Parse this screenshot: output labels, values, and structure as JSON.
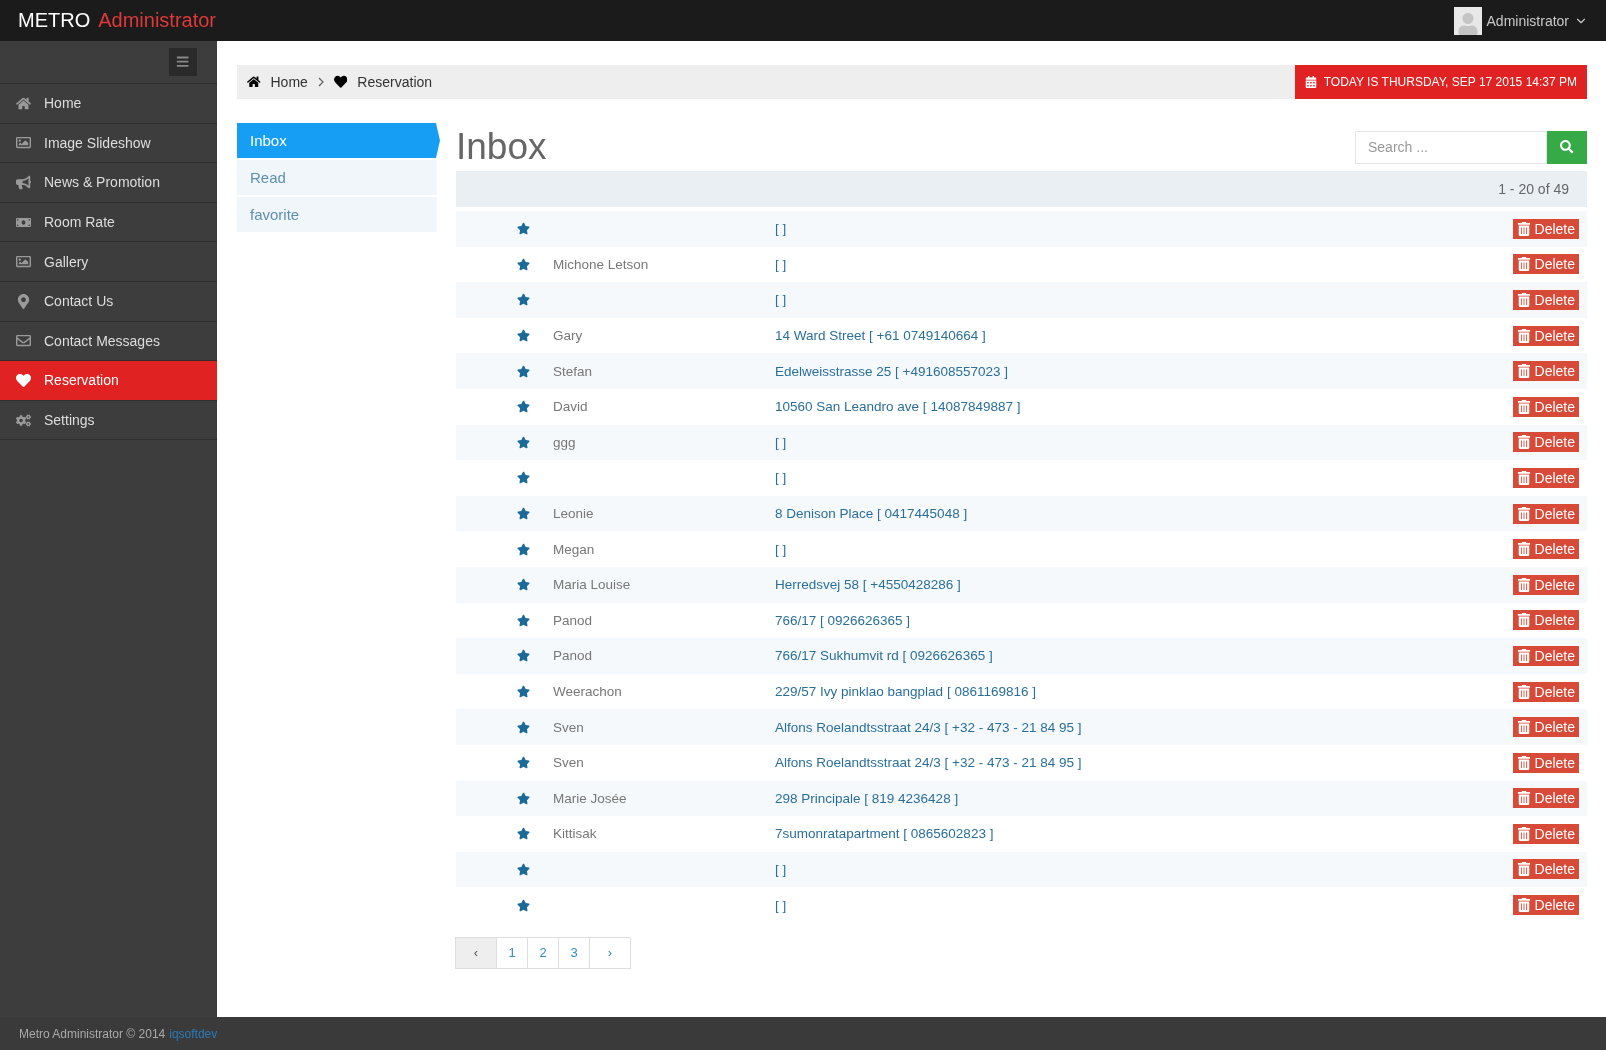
{
  "top_bar": {
    "brand": "METRO",
    "brand_accent": "Administrator",
    "user": "Administrator"
  },
  "sidebar": {
    "items": [
      {
        "label": "Home",
        "selected": false
      },
      {
        "label": "Image Slideshow",
        "selected": false
      },
      {
        "label": "News & Promotion",
        "selected": false
      },
      {
        "label": "Room Rate",
        "selected": false
      },
      {
        "label": "Gallery",
        "selected": false
      },
      {
        "label": "Contact Us",
        "selected": false
      },
      {
        "label": "Contact Messages",
        "selected": false
      },
      {
        "label": "Reservation",
        "selected": true
      },
      {
        "label": "Settings",
        "selected": false
      }
    ]
  },
  "breadcrumb": [
    {
      "label": "Home"
    },
    {
      "label": "Reservation"
    }
  ],
  "date_banner": "TODAY IS THURSDAY, SEP 17 2015 14:37 PM",
  "folders": [
    {
      "label": "Inbox",
      "selected": true
    },
    {
      "label": "Read",
      "selected": false
    },
    {
      "label": "favorite",
      "selected": false
    }
  ],
  "heading": "Inbox",
  "search": {
    "placeholder": "Search ..."
  },
  "range": "1 - 20 of 49",
  "rows": [
    {
      "contact": "[ ]",
      "action": "Delete"
    },
    {
      "name": "Michone Letson",
      "contact": "[ ]",
      "action": "Delete"
    },
    {
      "contact": "[ ]",
      "action": "Delete"
    },
    {
      "name": "Gary",
      "contact": "14 Ward Street [ +61 0749140664 ]",
      "action": "Delete"
    },
    {
      "name": "Stefan",
      "contact": "Edelweisstrasse 25 [ +491608557023 ]",
      "action": "Delete"
    },
    {
      "name": "David",
      "contact": "10560 San Leandro ave [ 14087849887 ]",
      "action": "Delete"
    },
    {
      "name": "ggg",
      "contact": "[ ]",
      "action": "Delete"
    },
    {
      "contact": "[ ]",
      "action": "Delete"
    },
    {
      "name": "Leonie",
      "contact": "8 Denison Place [ 0417445048 ]",
      "action": "Delete"
    },
    {
      "name": "Megan",
      "contact": "[ ]",
      "action": "Delete"
    },
    {
      "name": "Maria Louise",
      "contact": "Herredsvej 58 [ +4550428286 ]",
      "action": "Delete"
    },
    {
      "name": "Panod",
      "contact": "766/17 [ 0926626365 ]",
      "action": "Delete"
    },
    {
      "name": "Panod",
      "contact": "766/17 Sukhumvit rd [ 0926626365 ]",
      "action": "Delete"
    },
    {
      "name": "Weerachon",
      "contact": "229/57 Ivy pinklao bangplad [ 0861169816 ]",
      "action": "Delete"
    },
    {
      "name": "Sven",
      "contact": "Alfons Roelandtsstraat 24/3 [ +32 - 473 - 21 84 95 ]",
      "action": "Delete"
    },
    {
      "name": "Sven",
      "contact": "Alfons Roelandtsstraat 24/3 [ +32 - 473 - 21 84 95 ]",
      "action": "Delete"
    },
    {
      "name": "Marie Josée",
      "contact": "298 Principale [ 819 4236428 ]",
      "action": "Delete"
    },
    {
      "name": "Kittisak",
      "contact": "7sumonratapartment [ 0865602823 ]",
      "action": "Delete"
    },
    {
      "contact": "[ ]",
      "action": "Delete"
    },
    {
      "contact": "[ ]",
      "action": "Delete"
    }
  ],
  "pagination": {
    "prev": {
      "label": "‹",
      "disabled": true
    },
    "pages": [
      "1",
      "2",
      "3"
    ],
    "next": {
      "label": "›",
      "disabled": false
    }
  },
  "footer": {
    "text": "Metro Administrator © 2014",
    "link": "iqsoftdev"
  }
}
